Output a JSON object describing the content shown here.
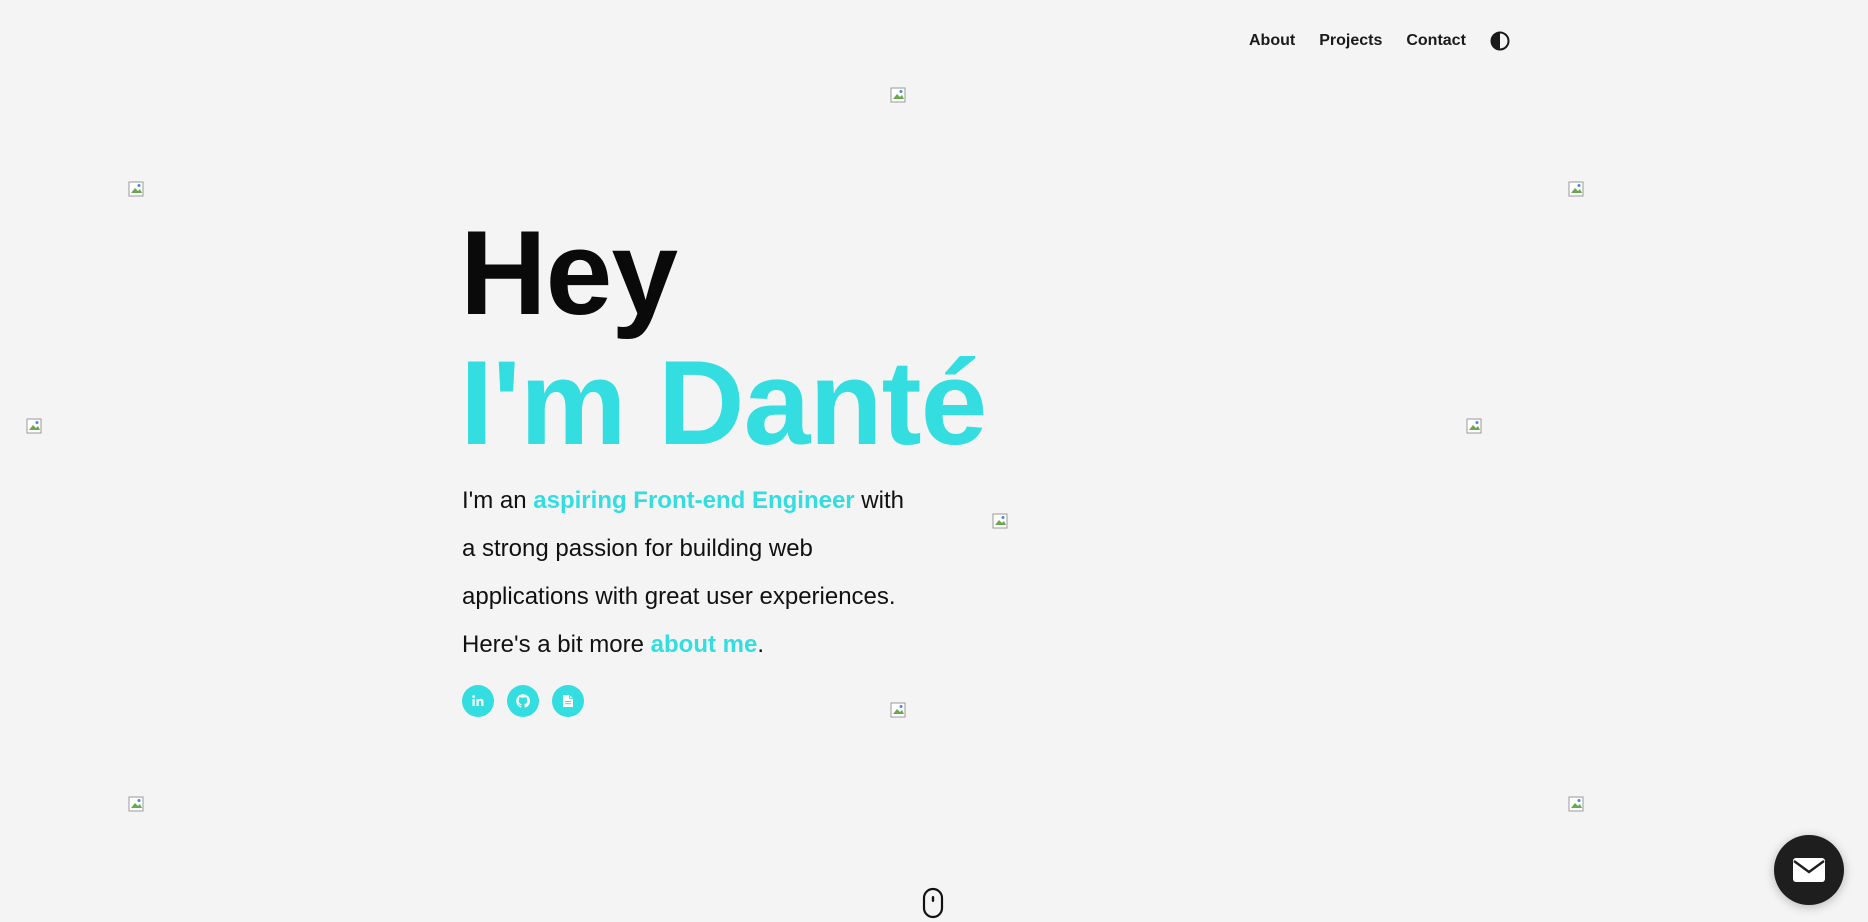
{
  "nav": {
    "items": [
      {
        "label": "About"
      },
      {
        "label": "Projects"
      },
      {
        "label": "Contact"
      }
    ],
    "theme_toggle_icon": "contrast-icon"
  },
  "hero": {
    "greeting": "Hey",
    "name": "I'm Danté",
    "intro_prefix": "I'm an ",
    "intro_role": "aspiring Front-end Engineer",
    "intro_middle": " with a strong passion for building web applications with great user experiences. Here's a bit more ",
    "intro_link": "about me",
    "intro_suffix": "."
  },
  "socials": [
    {
      "icon": "linkedin-icon"
    },
    {
      "icon": "github-icon"
    },
    {
      "icon": "resume-icon"
    }
  ],
  "scroll_indicator_icon": "mouse-scroll-icon",
  "mail_button_icon": "envelope-icon",
  "colors": {
    "accent": "#33dde0",
    "background": "#f4f4f4",
    "text": "#0a0a0a",
    "fab": "#1e1e1e"
  }
}
